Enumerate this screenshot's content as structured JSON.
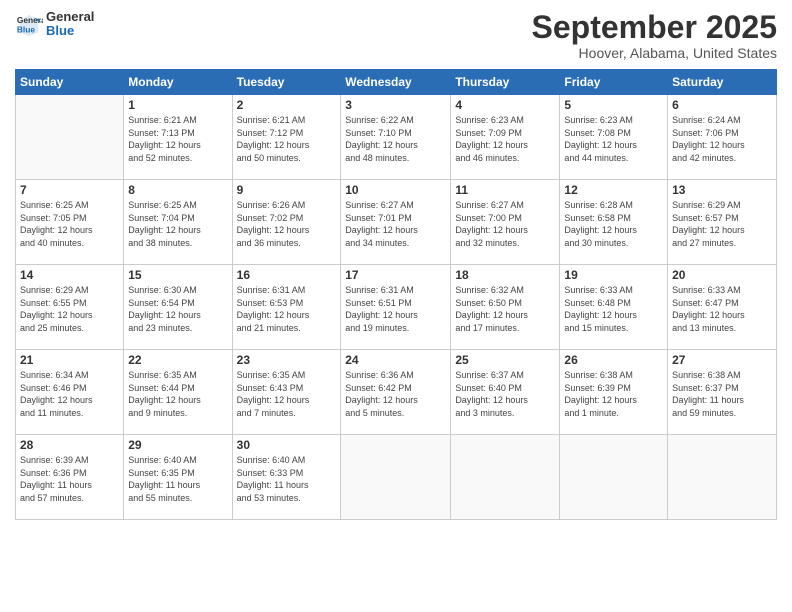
{
  "header": {
    "logo": {
      "general": "General",
      "blue": "Blue"
    },
    "title": "September 2025",
    "subtitle": "Hoover, Alabama, United States"
  },
  "weekdays": [
    "Sunday",
    "Monday",
    "Tuesday",
    "Wednesday",
    "Thursday",
    "Friday",
    "Saturday"
  ],
  "weeks": [
    [
      {
        "day": "",
        "info": ""
      },
      {
        "day": "1",
        "info": "Sunrise: 6:21 AM\nSunset: 7:13 PM\nDaylight: 12 hours\nand 52 minutes."
      },
      {
        "day": "2",
        "info": "Sunrise: 6:21 AM\nSunset: 7:12 PM\nDaylight: 12 hours\nand 50 minutes."
      },
      {
        "day": "3",
        "info": "Sunrise: 6:22 AM\nSunset: 7:10 PM\nDaylight: 12 hours\nand 48 minutes."
      },
      {
        "day": "4",
        "info": "Sunrise: 6:23 AM\nSunset: 7:09 PM\nDaylight: 12 hours\nand 46 minutes."
      },
      {
        "day": "5",
        "info": "Sunrise: 6:23 AM\nSunset: 7:08 PM\nDaylight: 12 hours\nand 44 minutes."
      },
      {
        "day": "6",
        "info": "Sunrise: 6:24 AM\nSunset: 7:06 PM\nDaylight: 12 hours\nand 42 minutes."
      }
    ],
    [
      {
        "day": "7",
        "info": "Sunrise: 6:25 AM\nSunset: 7:05 PM\nDaylight: 12 hours\nand 40 minutes."
      },
      {
        "day": "8",
        "info": "Sunrise: 6:25 AM\nSunset: 7:04 PM\nDaylight: 12 hours\nand 38 minutes."
      },
      {
        "day": "9",
        "info": "Sunrise: 6:26 AM\nSunset: 7:02 PM\nDaylight: 12 hours\nand 36 minutes."
      },
      {
        "day": "10",
        "info": "Sunrise: 6:27 AM\nSunset: 7:01 PM\nDaylight: 12 hours\nand 34 minutes."
      },
      {
        "day": "11",
        "info": "Sunrise: 6:27 AM\nSunset: 7:00 PM\nDaylight: 12 hours\nand 32 minutes."
      },
      {
        "day": "12",
        "info": "Sunrise: 6:28 AM\nSunset: 6:58 PM\nDaylight: 12 hours\nand 30 minutes."
      },
      {
        "day": "13",
        "info": "Sunrise: 6:29 AM\nSunset: 6:57 PM\nDaylight: 12 hours\nand 27 minutes."
      }
    ],
    [
      {
        "day": "14",
        "info": "Sunrise: 6:29 AM\nSunset: 6:55 PM\nDaylight: 12 hours\nand 25 minutes."
      },
      {
        "day": "15",
        "info": "Sunrise: 6:30 AM\nSunset: 6:54 PM\nDaylight: 12 hours\nand 23 minutes."
      },
      {
        "day": "16",
        "info": "Sunrise: 6:31 AM\nSunset: 6:53 PM\nDaylight: 12 hours\nand 21 minutes."
      },
      {
        "day": "17",
        "info": "Sunrise: 6:31 AM\nSunset: 6:51 PM\nDaylight: 12 hours\nand 19 minutes."
      },
      {
        "day": "18",
        "info": "Sunrise: 6:32 AM\nSunset: 6:50 PM\nDaylight: 12 hours\nand 17 minutes."
      },
      {
        "day": "19",
        "info": "Sunrise: 6:33 AM\nSunset: 6:48 PM\nDaylight: 12 hours\nand 15 minutes."
      },
      {
        "day": "20",
        "info": "Sunrise: 6:33 AM\nSunset: 6:47 PM\nDaylight: 12 hours\nand 13 minutes."
      }
    ],
    [
      {
        "day": "21",
        "info": "Sunrise: 6:34 AM\nSunset: 6:46 PM\nDaylight: 12 hours\nand 11 minutes."
      },
      {
        "day": "22",
        "info": "Sunrise: 6:35 AM\nSunset: 6:44 PM\nDaylight: 12 hours\nand 9 minutes."
      },
      {
        "day": "23",
        "info": "Sunrise: 6:35 AM\nSunset: 6:43 PM\nDaylight: 12 hours\nand 7 minutes."
      },
      {
        "day": "24",
        "info": "Sunrise: 6:36 AM\nSunset: 6:42 PM\nDaylight: 12 hours\nand 5 minutes."
      },
      {
        "day": "25",
        "info": "Sunrise: 6:37 AM\nSunset: 6:40 PM\nDaylight: 12 hours\nand 3 minutes."
      },
      {
        "day": "26",
        "info": "Sunrise: 6:38 AM\nSunset: 6:39 PM\nDaylight: 12 hours\nand 1 minute."
      },
      {
        "day": "27",
        "info": "Sunrise: 6:38 AM\nSunset: 6:37 PM\nDaylight: 11 hours\nand 59 minutes."
      }
    ],
    [
      {
        "day": "28",
        "info": "Sunrise: 6:39 AM\nSunset: 6:36 PM\nDaylight: 11 hours\nand 57 minutes."
      },
      {
        "day": "29",
        "info": "Sunrise: 6:40 AM\nSunset: 6:35 PM\nDaylight: 11 hours\nand 55 minutes."
      },
      {
        "day": "30",
        "info": "Sunrise: 6:40 AM\nSunset: 6:33 PM\nDaylight: 11 hours\nand 53 minutes."
      },
      {
        "day": "",
        "info": ""
      },
      {
        "day": "",
        "info": ""
      },
      {
        "day": "",
        "info": ""
      },
      {
        "day": "",
        "info": ""
      }
    ]
  ]
}
